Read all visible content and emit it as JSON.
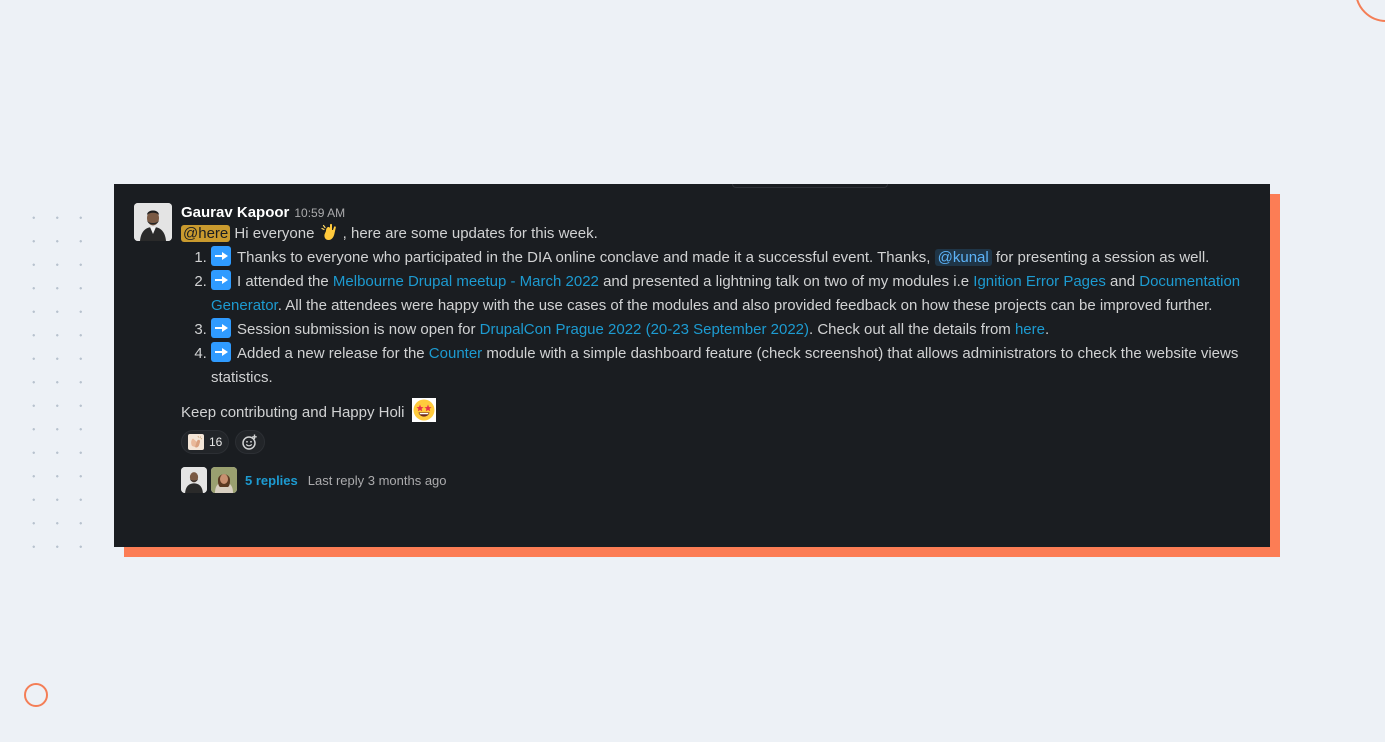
{
  "message": {
    "author": "Gaurav Kapoor",
    "time": "10:59 AM",
    "intro": {
      "mention": "@here",
      "before_icon": "Hi everyone",
      "after_icon": ", here are some updates for this week.",
      "icon": "waving-hand-icon"
    },
    "items": [
      {
        "t1": "Thanks to everyone who participated in the DIA online conclave and made it a successful event. Thanks, ",
        "mention": "@kunal",
        "t2": " for presenting a session as well."
      },
      {
        "t1": "I attended the ",
        "link1": "Melbourne Drupal meetup - March 2022",
        "t2": " and presented a lightning talk on two of my modules i.e ",
        "link2": "Ignition Error Pages",
        "t3": " and ",
        "link3": "Documentation Generator",
        "t4": ". All the attendees were happy with the use cases of the modules and also provided feedback on how these projects can be improved further."
      },
      {
        "t1": "Session submission is now open for ",
        "link1": "DrupalCon Prague 2022 (20-23 September 2022)",
        "t2": ". Check out all the details from ",
        "link2": "here",
        "t3": "."
      },
      {
        "t1": "Added a new release for the ",
        "link1": "Counter",
        "t2": " module with a simple dashboard feature (check screenshot) that allows administrators to check the website views statistics."
      }
    ],
    "closing": "Keep contributing and Happy Holi",
    "closing_icon": "star-struck-face-icon",
    "reaction": {
      "icon": "clapping-hands-icon",
      "count": "16"
    },
    "thread": {
      "replies": "5 replies",
      "last_reply": "Last reply 3 months ago"
    }
  },
  "colors": {
    "panel": "#1a1d21",
    "accent": "#fc7d55",
    "link": "#1d9bd1",
    "here_highlight": "#c99a2e"
  }
}
